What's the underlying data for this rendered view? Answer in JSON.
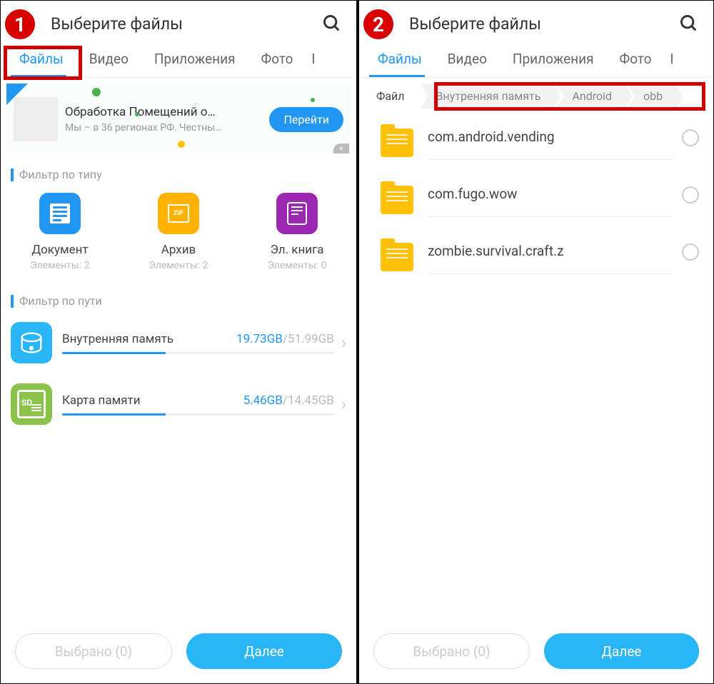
{
  "badge1": "1",
  "badge2": "2",
  "header_title": "Выберите файлы",
  "tabs": {
    "files": "Файлы",
    "video": "Видео",
    "apps": "Приложения",
    "photo": "Фото",
    "more": "I"
  },
  "ad": {
    "title": "Обработка Помещений о…",
    "sub": "Мы – в 36 регионах РФ. Честны…",
    "button": "Перейти"
  },
  "section_type": "Фильтр по типу",
  "types": {
    "doc": {
      "label": "Документ",
      "count": "Элементы: 2"
    },
    "zip": {
      "label": "Архив",
      "count": "Элементы: 2",
      "icon_text": "ZIP"
    },
    "ebook": {
      "label": "Эл. книга",
      "count": "Элементы: 0"
    }
  },
  "section_path": "Фильтр по пути",
  "storage": {
    "internal": {
      "name": "Внутренняя память",
      "used": "19.73GB",
      "total": "/51.99GB",
      "pct": 38
    },
    "sd": {
      "name": "Карта памяти",
      "used": "5.46GB",
      "total": "/14.45GB",
      "pct": 38,
      "icon_label": "SD"
    }
  },
  "breadcrumb": {
    "root": "Файл",
    "b1": "Внутренняя память",
    "b2": "Android",
    "b3": "obb"
  },
  "folders": {
    "f1": "com.android.vending",
    "f2": "com.fugo.wow",
    "f3": "zombie.survival.craft.z"
  },
  "footer": {
    "selected": "Выбрано (0)",
    "next": "Далее"
  }
}
